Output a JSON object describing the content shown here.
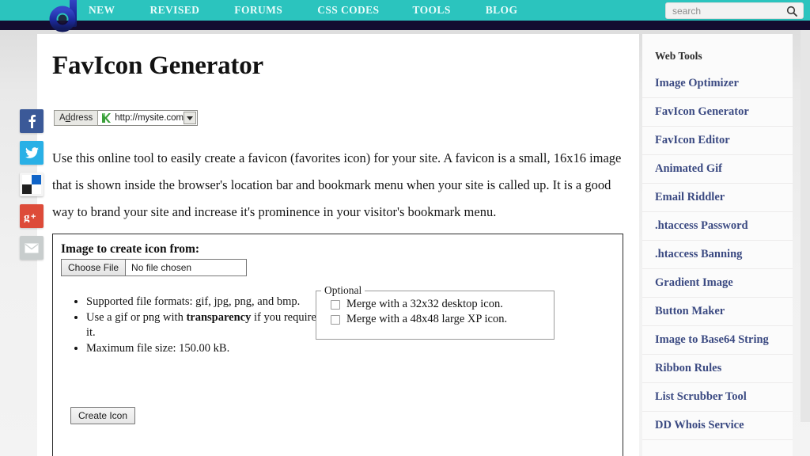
{
  "header": {
    "nav": [
      {
        "label": "NEW",
        "name": "nav-new"
      },
      {
        "label": "REVISED",
        "name": "nav-revised"
      },
      {
        "label": "FORUMS",
        "name": "nav-forums"
      },
      {
        "label": "CSS CODES",
        "name": "nav-css-codes"
      },
      {
        "label": "TOOLS",
        "name": "nav-tools"
      },
      {
        "label": "BLOG",
        "name": "nav-blog"
      }
    ],
    "logo_letter": "d",
    "search": {
      "placeholder": "search",
      "value": "",
      "icon": "search-icon"
    },
    "colors": {
      "teal": "#2bc4be",
      "dark_band": "#130c30",
      "logo_blue": "#1f2f9e"
    }
  },
  "main": {
    "title": "FavIcon Generator",
    "address_bar": {
      "label_pre": "A",
      "label_underline": "d",
      "label_post": "dress",
      "site_icon": "green-app-icon",
      "url": "http://mysite.com/",
      "dropdown_icon": "chevron-down-icon"
    },
    "intro": "Use this online tool to easily create a favicon (favorites icon) for your site. A favicon is a small, 16x16 image that is shown inside the browser's location bar and bookmark menu when your site is called up. It is a good way to brand your site and increase it's prominence in your visitor's bookmark menu.",
    "form": {
      "heading": "Image to create icon from:",
      "choose_file_label": "Choose File",
      "file_status": "No file chosen",
      "bullets": [
        {
          "text": "Supported file formats: gif, jpg, png, and bmp.",
          "bold": ""
        },
        {
          "pre": "Use a gif or png with ",
          "bold": "transparency",
          "post": " if you require it."
        },
        {
          "text": "Maximum file size: 150.00 kB.",
          "bold": ""
        }
      ],
      "optional": {
        "legend": "Optional",
        "options": [
          {
            "label": "Merge with a 32x32 desktop icon.",
            "checked": false
          },
          {
            "label": "Merge with a 48x48 large XP icon.",
            "checked": false
          }
        ]
      },
      "submit_label": "Create Icon"
    }
  },
  "sidebar": {
    "title": "Web Tools",
    "items": [
      {
        "label": "Image Optimizer"
      },
      {
        "label": "FavIcon Generator"
      },
      {
        "label": "FavIcon Editor"
      },
      {
        "label": "Animated Gif"
      },
      {
        "label": "Email Riddler"
      },
      {
        "label": ".htaccess Password"
      },
      {
        "label": ".htaccess Banning"
      },
      {
        "label": "Gradient Image"
      },
      {
        "label": "Button Maker"
      },
      {
        "label": "Image to Base64 String"
      },
      {
        "label": "Ribbon Rules"
      },
      {
        "label": "List Scrubber Tool"
      },
      {
        "label": "DD Whois Service"
      }
    ],
    "link_color": "#3b4a82"
  },
  "social": [
    {
      "name": "facebook-share-icon",
      "glyph": "f",
      "color": "#3b5998"
    },
    {
      "name": "twitter-share-icon",
      "glyph": "",
      "color": "#29b0e6"
    },
    {
      "name": "delicious-share-icon",
      "glyph": "",
      "color": "#ffffff"
    },
    {
      "name": "googleplus-share-icon",
      "glyph": "g+",
      "color": "#dd4b39"
    },
    {
      "name": "email-share-icon",
      "glyph": "",
      "color": "#c8cdcd"
    }
  ]
}
